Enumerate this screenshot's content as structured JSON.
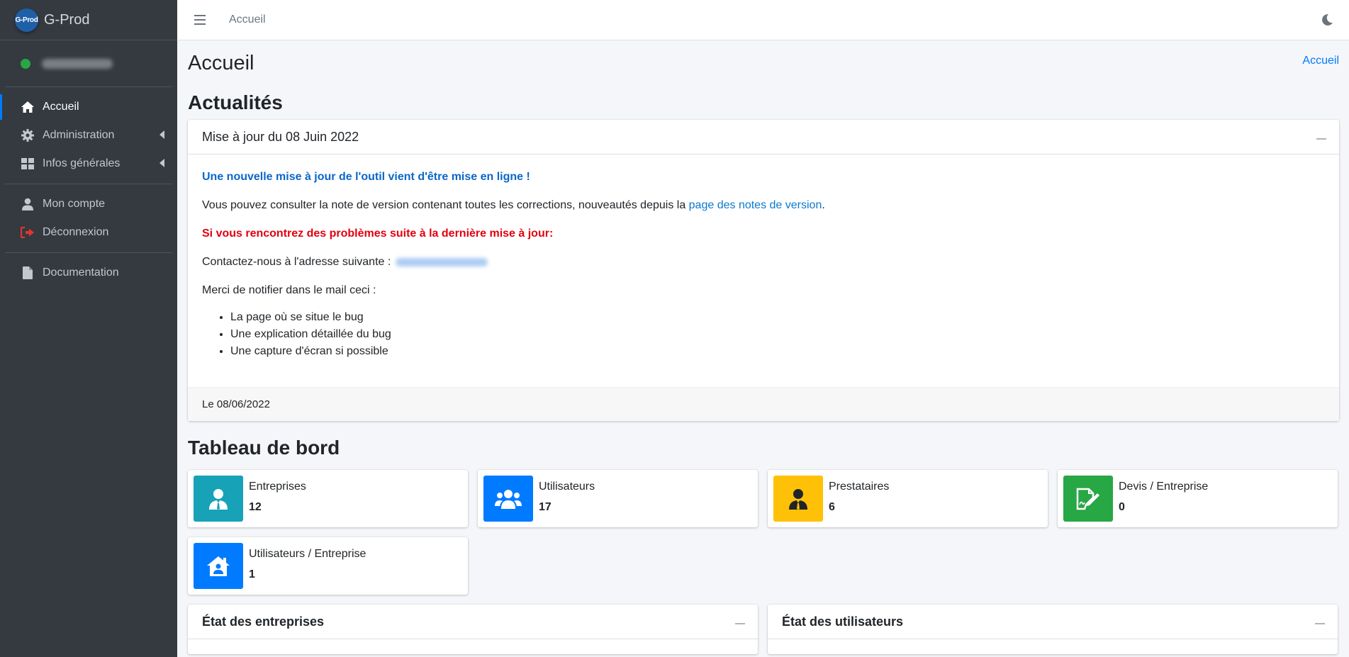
{
  "app": {
    "logo_text": "G-Prod",
    "brand_name": "G-Prod"
  },
  "sidebar": {
    "items": [
      {
        "label": "Accueil",
        "icon": "home-icon",
        "active": true
      },
      {
        "label": "Administration",
        "icon": "gear-icon",
        "has_children": true
      },
      {
        "label": "Infos générales",
        "icon": "grid-icon",
        "has_children": true
      },
      {
        "label": "Mon compte",
        "icon": "user-icon"
      },
      {
        "label": "Déconnexion",
        "icon": "sign-out-icon"
      },
      {
        "label": "Documentation",
        "icon": "file-icon"
      }
    ]
  },
  "topbar": {
    "link": "Accueil",
    "icons": [
      "hamburger-menu-icon",
      "moon-icon"
    ]
  },
  "page": {
    "title": "Accueil",
    "breadcrumb": "Accueil"
  },
  "news": {
    "section_title": "Actualités",
    "card_title": "Mise à jour du 08 Juin 2022",
    "headline": "Une nouvelle mise à jour de l'outil vient d'être mise en ligne !",
    "paragraph_prefix": "Vous pouvez consulter la note de version contenant toutes les corrections, nouveautés depuis la ",
    "paragraph_link": "page des notes de version",
    "paragraph_suffix": ".",
    "warning": "Si vous rencontrez des problèmes suite à la dernière mise à jour:",
    "contact": "Contactez-nous à l'adresse suivante :",
    "notify": "Merci de notifier dans le mail ceci :",
    "list": [
      "La page où se situe le bug",
      "Une explication détaillée du bug",
      "Une capture d'écran si possible"
    ],
    "footer": "Le 08/06/2022"
  },
  "dashboard": {
    "section_title": "Tableau de bord",
    "stats": [
      {
        "label": "Entreprises",
        "value": "12",
        "color": "#17a2b8",
        "icon": "user-tie-icon"
      },
      {
        "label": "Utilisateurs",
        "value": "17",
        "color": "#007bff",
        "icon": "users-icon"
      },
      {
        "label": "Prestataires",
        "value": "6",
        "color": "#ffc107",
        "icon": "user-tie-icon"
      },
      {
        "label": "Devis / Entreprise",
        "value": "0",
        "color": "#28a745",
        "icon": "signature-icon"
      },
      {
        "label": "Utilisateurs / Entreprise",
        "value": "1",
        "color": "#007bff",
        "icon": "house-user-icon"
      }
    ],
    "panels": [
      {
        "title": "État des entreprises"
      },
      {
        "title": "État des utilisateurs"
      }
    ]
  }
}
